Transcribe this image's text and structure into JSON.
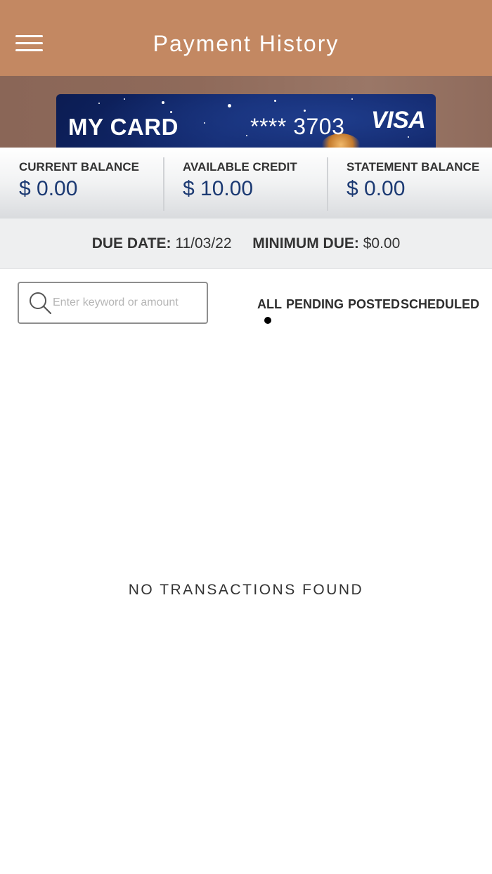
{
  "header": {
    "title": "Payment History",
    "menu_icon": "hamburger-menu-icon",
    "background_color": "#c38862"
  },
  "card": {
    "label": "MY CARD",
    "number_masked": "**** 3703",
    "brand": "VISA"
  },
  "balances": [
    {
      "label": "CURRENT BALANCE",
      "value": "$ 0.00"
    },
    {
      "label": "AVAILABLE CREDIT",
      "value": "$ 10.00"
    },
    {
      "label": "STATEMENT BALANCE",
      "value": "$ 0.00"
    }
  ],
  "due": {
    "due_date_label": "DUE DATE:",
    "due_date_value": "11/03/22",
    "minimum_due_label": "MINIMUM DUE:",
    "minimum_due_value": "$0.00"
  },
  "search": {
    "placeholder": "Enter keyword or amount",
    "value": "",
    "icon": "search-icon"
  },
  "filters": {
    "items": [
      "ALL",
      "PENDING",
      "POSTED",
      "SCHEDULED"
    ],
    "selected": "ALL"
  },
  "empty_state": {
    "message": "NO TRANSACTIONS FOUND"
  },
  "colors": {
    "balance_value": "#1c3a73",
    "card_background": "#132a70"
  }
}
